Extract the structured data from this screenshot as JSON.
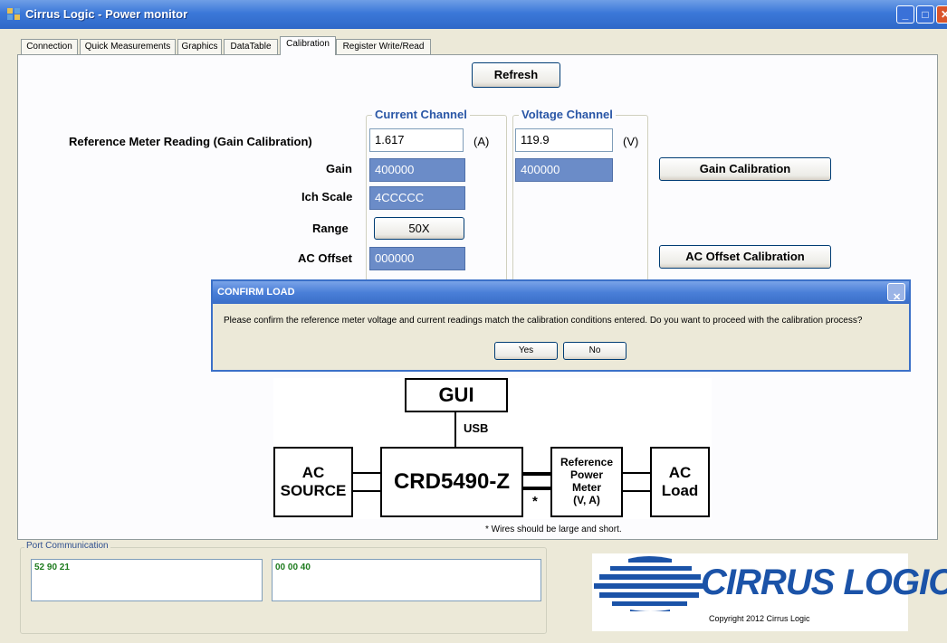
{
  "window": {
    "title": "Cirrus Logic - Power monitor"
  },
  "tabs": [
    {
      "label": "Connection",
      "active": false
    },
    {
      "label": "Quick Measurements",
      "active": false
    },
    {
      "label": "Graphics",
      "active": false
    },
    {
      "label": "DataTable",
      "active": false
    },
    {
      "label": "Calibration",
      "active": true
    },
    {
      "label": "Register Write/Read",
      "active": false
    }
  ],
  "calibration": {
    "refresh_label": "Refresh",
    "current_channel_label": "Current Channel",
    "voltage_channel_label": "Voltage Channel",
    "ref_meter_label": "Reference Meter Reading (Gain Calibration)",
    "current_reading": "1.617",
    "current_unit": "(A)",
    "voltage_reading": "119.9",
    "voltage_unit": "(V)",
    "gain_label": "Gain",
    "current_gain": "400000",
    "voltage_gain": "400000",
    "gain_cal_button": "Gain Calibration",
    "ich_scale_label": "Ich Scale",
    "ich_scale_value": "4CCCCC",
    "range_label": "Range",
    "range_value": "50X",
    "ac_offset_label": "AC Offset",
    "ac_offset_value": "000000",
    "ac_offset_cal_button": "AC Offset Calibration"
  },
  "dialog": {
    "title": "CONFIRM LOAD",
    "message": "Please confirm the reference meter voltage and current readings match the calibration conditions entered. Do you want to proceed with the calibration process?",
    "yes_label": "Yes",
    "no_label": "No"
  },
  "diagram": {
    "gui": "GUI",
    "usb": "USB",
    "ac_source_line1": "AC",
    "ac_source_line2": "SOURCE",
    "board": "CRD5490-Z",
    "ref_line1": "Reference",
    "ref_line2": "Power",
    "ref_line3": "Meter",
    "ref_line4": "(V, A)",
    "ac_load_line1": "AC",
    "ac_load_line2": "Load",
    "asterisk": "*",
    "note": "* Wires should be large and short."
  },
  "port_communication": {
    "label": "Port Communication",
    "tx": "52 90 21",
    "rx": "00 00 40"
  },
  "footer": {
    "logo_text": "CIRRUS LOGIC",
    "copyright": "Copyright 2012 Cirrus Logic"
  },
  "colors": {
    "accent": "#2956a6",
    "field_blue": "#6b8cc8",
    "titlebar": "#3b78d8"
  }
}
